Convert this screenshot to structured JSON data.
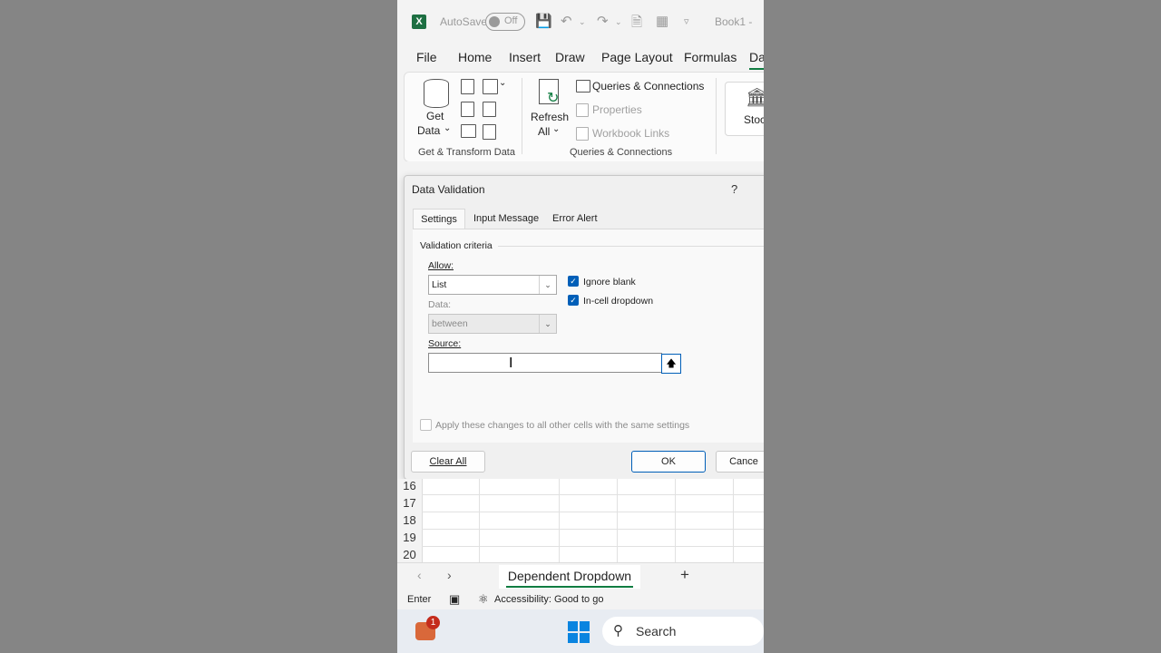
{
  "app": {
    "autosave_label": "AutoSave",
    "autosave_state": "Off",
    "book_title": "Book1 -"
  },
  "menu_tabs": [
    "File",
    "Home",
    "Insert",
    "Draw",
    "Page Layout",
    "Formulas",
    "Da"
  ],
  "ribbon": {
    "get_data_line1": "Get",
    "get_data_line2": "Data",
    "get_transform_label": "Get & Transform Data",
    "refresh_line1": "Refresh",
    "refresh_line2": "All",
    "queries_connections": "Queries & Connections",
    "properties": "Properties",
    "workbook_links": "Workbook Links",
    "queries_group_label": "Queries & Connections",
    "stocks_partial": "Stoc"
  },
  "dialog": {
    "title": "Data Validation",
    "help": "?",
    "tabs": [
      "Settings",
      "Input Message",
      "Error Alert"
    ],
    "criteria_label": "Validation criteria",
    "allow_label": "Allow:",
    "allow_value": "List",
    "data_label": "Data:",
    "data_value": "between",
    "ignore_blank": "Ignore blank",
    "incell_dropdown": "In-cell dropdown",
    "source_label": "Source:",
    "source_value": "",
    "apply_all": "Apply these changes to all other cells with the same settings",
    "clear_all": "Clear All",
    "ok": "OK",
    "cancel": "Cance"
  },
  "rows": [
    "16",
    "17",
    "18",
    "19",
    "20"
  ],
  "sheet_tab": "Dependent Dropdown",
  "add_sheet": "+",
  "status": {
    "mode": "Enter",
    "accessibility": "Accessibility: Good to go"
  },
  "taskbar": {
    "badge": "1",
    "search_placeholder": "Search"
  }
}
